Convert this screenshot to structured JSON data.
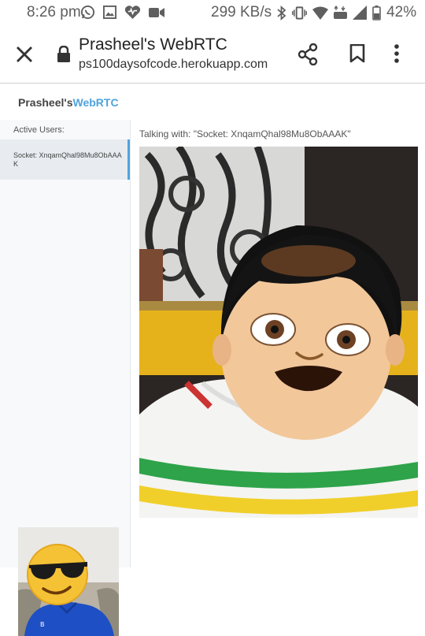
{
  "status_bar": {
    "time": "8:26 pm",
    "net_speed": "299 KB/s",
    "battery": "42%",
    "icons": [
      "whatsapp-icon",
      "gallery-icon",
      "heart-icon",
      "video-call-icon",
      "bluetooth-icon",
      "vibrate-icon",
      "wifi-icon",
      "lte-icon",
      "signal-icon",
      "battery-icon"
    ]
  },
  "browser": {
    "page_title": "Prasheel's WebRTC",
    "url": "ps100daysofcode.herokuapp.com"
  },
  "app": {
    "brand_prefix": "Prasheel's",
    "brand_accent": "WebRTC",
    "accent_color": "#4fa3dc"
  },
  "sidebar": {
    "heading": "Active Users:",
    "users": [
      {
        "label": "Socket: XnqamQhal98Mu8ObAAAK"
      }
    ]
  },
  "main": {
    "talking_with": "Talking with: \"Socket: XnqamQhal98Mu8ObAAAK\""
  }
}
